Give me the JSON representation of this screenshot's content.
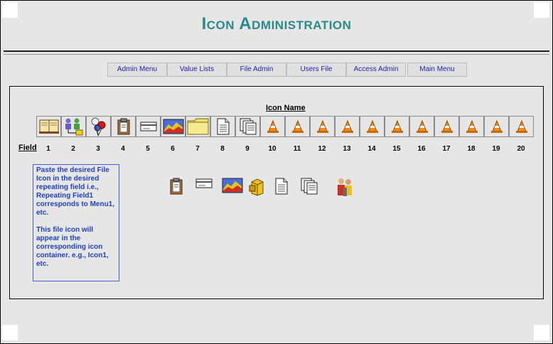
{
  "title": "Icon Administration",
  "nav": [
    {
      "label": "Admin Menu"
    },
    {
      "label": "Value Lists"
    },
    {
      "label": "File Admin"
    },
    {
      "label": "Users File"
    },
    {
      "label": "Access Admin"
    },
    {
      "label": "Main Menu"
    }
  ],
  "icon_name_label": "Icon Name",
  "field_label": "Field",
  "fields": [
    "1",
    "2",
    "3",
    "4",
    "5",
    "6",
    "7",
    "8",
    "9",
    "10",
    "11",
    "12",
    "13",
    "14",
    "15",
    "16",
    "17",
    "18",
    "19",
    "20"
  ],
  "slot_icons": [
    "book-icon",
    "users-icon",
    "balloons-icon",
    "clipboard-icon",
    "card-icon",
    "chart-icon",
    "folder-icon",
    "document-icon",
    "documents-icon",
    "cone-icon",
    "cone-icon",
    "cone-icon",
    "cone-icon",
    "cone-icon",
    "cone-icon",
    "cone-icon",
    "cone-icon",
    "cone-icon",
    "cone-icon",
    "cone-icon"
  ],
  "note": {
    "para1": "Paste the desired File Icon in the desired repeating field i.e., Repeating Field1 corresponds to Menu1, etc.",
    "para2": "This file icon will appear in the corresponding icon container.  e.g., Icon1, etc."
  },
  "source_icons": [
    "clipboard-icon",
    "card-icon",
    "chart-icon",
    "box-icon",
    "document-icon",
    "documents-icon",
    "people-icon"
  ]
}
